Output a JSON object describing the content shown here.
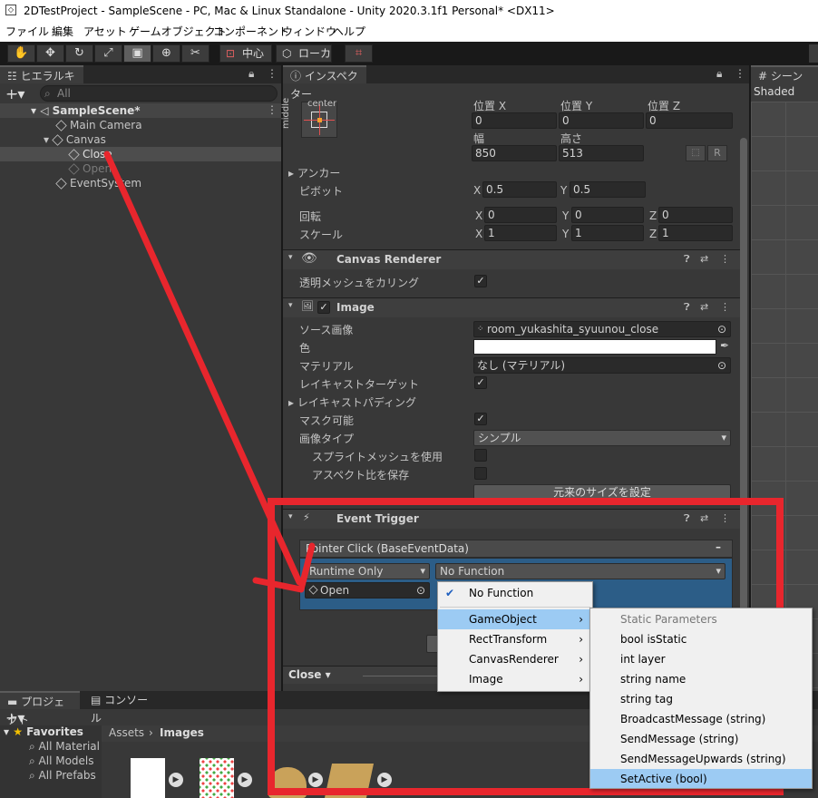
{
  "window": {
    "title": "2DTestProject - SampleScene - PC, Mac & Linux Standalone - Unity 2020.3.1f1 Personal* <DX11>"
  },
  "menubar": [
    "ファイル",
    "編集",
    "アセット",
    "ゲームオブジェクト",
    "コンポーネント",
    "ウィンドウ",
    "ヘルプ"
  ],
  "toolbar": {
    "pivot_label": "中心",
    "space_label": "ローカル"
  },
  "hierarchy": {
    "tab": "ヒエラルキー",
    "search_placeholder": "All",
    "items": [
      {
        "label": "SampleScene*"
      },
      {
        "label": "Main Camera"
      },
      {
        "label": "Canvas"
      },
      {
        "label": "Close"
      },
      {
        "label": "Open"
      },
      {
        "label": "EventSystem"
      }
    ]
  },
  "inspector": {
    "tab": "インスペクター",
    "rect": {
      "anchor_preset_top": "center",
      "anchor_preset_side": "middle",
      "pos_x_label": "位置 X",
      "pos_y_label": "位置 Y",
      "pos_z_label": "位置 Z",
      "pos_x": "0",
      "pos_y": "0",
      "pos_z": "0",
      "width_label": "幅",
      "height_label": "高さ",
      "width": "850",
      "height": "513",
      "r_btn": "R",
      "anchors_label": "アンカー",
      "pivot_label": "ピボット",
      "pivot_x": "0.5",
      "pivot_y": "0.5",
      "rotation_label": "回転",
      "rot_x": "0",
      "rot_y": "0",
      "rot_z": "0",
      "scale_label": "スケール",
      "scale_x": "1",
      "scale_y": "1",
      "scale_z": "1",
      "x": "X",
      "y": "Y",
      "z": "Z"
    },
    "canvas_renderer": {
      "title": "Canvas Renderer",
      "cull_label": "透明メッシュをカリング"
    },
    "image": {
      "title": "Image",
      "source_label": "ソース画像",
      "source_value": "room_yukashita_syuunou_close",
      "color_label": "色",
      "material_label": "マテリアル",
      "material_value": "なし (マテリアル)",
      "raycast_label": "レイキャストターゲット",
      "raycast_padding_label": "レイキャストパディング",
      "maskable_label": "マスク可能",
      "image_type_label": "画像タイプ",
      "image_type_value": "シンプル",
      "use_sprite_mesh_label": "スプライトメッシュを使用",
      "preserve_aspect_label": "アスペクト比を保存",
      "native_size_button": "元来のサイズを設定"
    },
    "event_trigger": {
      "title": "Event Trigger",
      "event_label": "Pointer Click (BaseEventData)",
      "runtime_value": "Runtime Only",
      "function_value": "No Function",
      "object_value": "Open"
    },
    "footer_label": "Close"
  },
  "scene": {
    "tab": "シーン",
    "shading": "Shaded"
  },
  "project": {
    "tab1": "プロジェクト",
    "tab2": "コンソール",
    "favorites_label": "Favorites",
    "fav_items": [
      "All Material",
      "All Models",
      "All Prefabs"
    ],
    "breadcrumb_assets": "Assets",
    "breadcrumb_images": "Images"
  },
  "function_menu": {
    "no_function": "No Function",
    "items": [
      "GameObject",
      "RectTransform",
      "CanvasRenderer",
      "Image"
    ]
  },
  "submenu": {
    "header": "Static Parameters",
    "items": [
      "bool isStatic",
      "int layer",
      "string name",
      "string tag",
      "BroadcastMessage (string)",
      "SendMessage (string)",
      "SendMessageUpwards (string)",
      "SetActive (bool)"
    ]
  },
  "colors": {
    "annotation_red": "#e8262d",
    "selection_blue": "#2c5d87",
    "menu_highlight": "#9ccbf3"
  }
}
